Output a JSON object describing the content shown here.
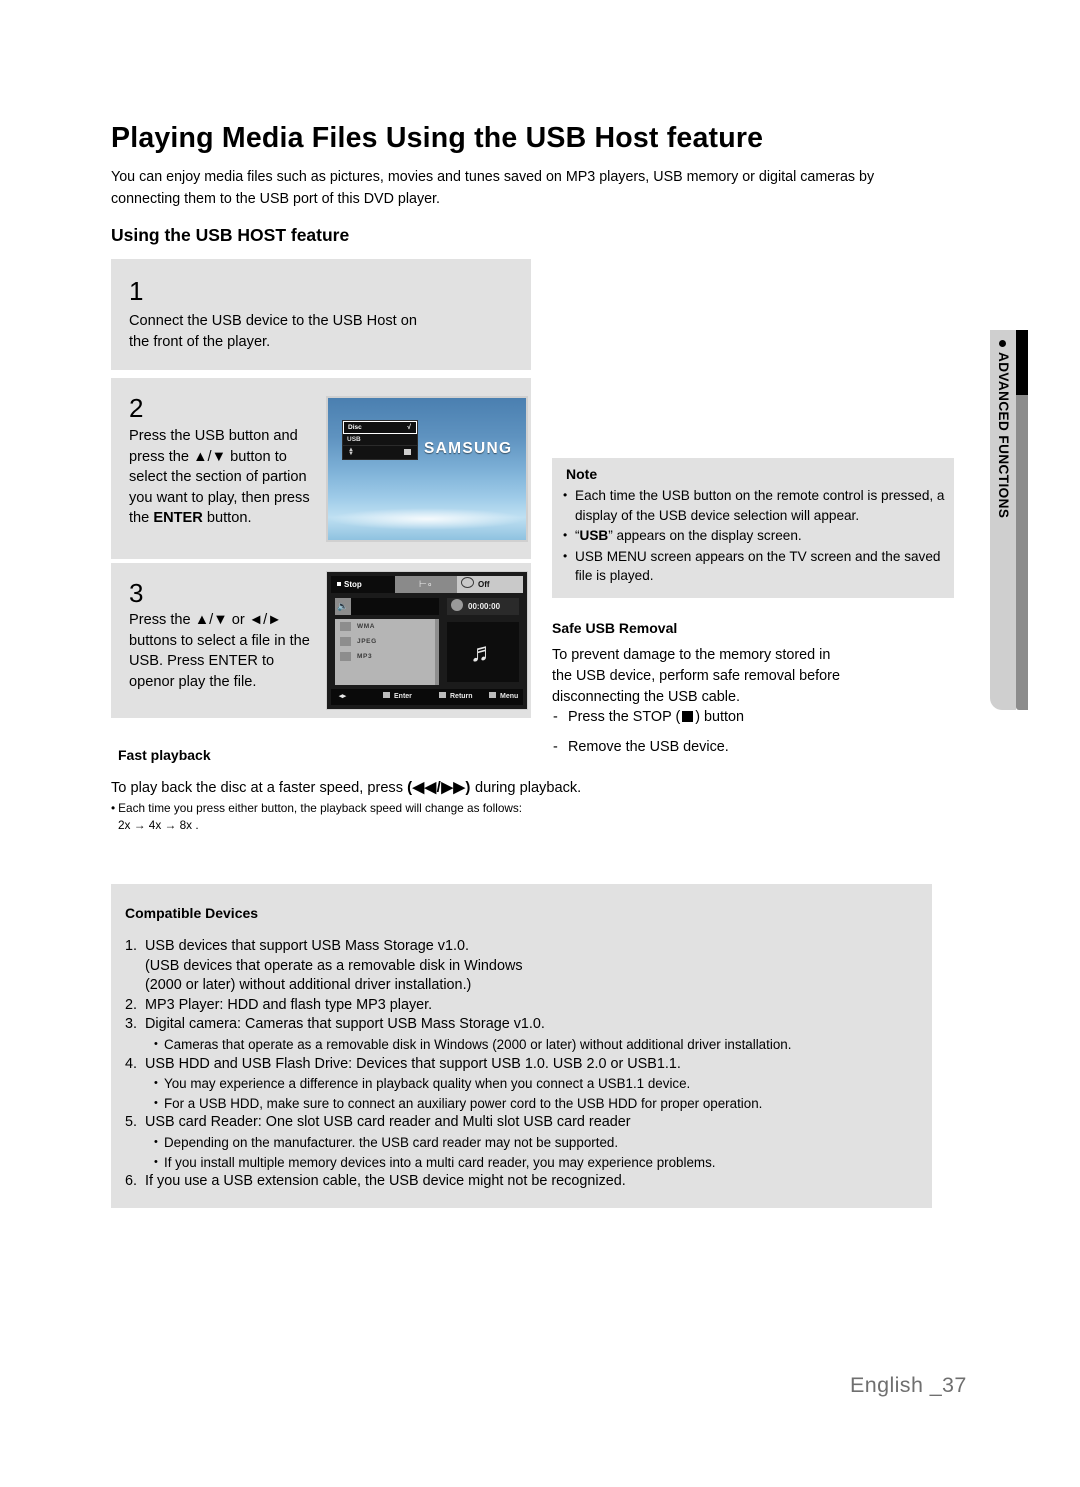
{
  "page": {
    "title": "Playing Media Files Using the USB Host feature",
    "intro": "You can enjoy media files such as pictures, movies and tunes saved on MP3 players, USB memory or digital cameras by connecting them to the USB port of this DVD player.",
    "section_heading": "Using the USB HOST feature",
    "footer": "English _37"
  },
  "side_tab": {
    "label": "ADVANCED FUNCTIONS",
    "dot": "●"
  },
  "steps": [
    {
      "number": "1",
      "text": "Connect the USB device to the USB Host on\n the front of the player."
    },
    {
      "number": "2",
      "text_before": "Press the USB button and\npress  the ▲/▼ button to\nselect the  section of partion\nyou want to play, then press\nthe  ",
      "text_bold": "ENTER",
      "text_after": " button."
    },
    {
      "number": "3",
      "text": "Press the  ▲/▼ or ◄/►\nbuttons to select a file in the\nUSB. Press ENTER to\nopenor play the file."
    }
  ],
  "tv_screen": {
    "logo": "SAMSUNG",
    "menu": [
      {
        "label": "Disc",
        "selected": true,
        "check": "√"
      },
      {
        "label": "USB",
        "selected": false,
        "check": ""
      }
    ]
  },
  "osd_screen": {
    "status": "Stop",
    "repeat": "Off",
    "time": "00:00:00",
    "file_types": [
      "WMA",
      "JPEG",
      "MP3"
    ],
    "buttons": [
      "Enter",
      "Return",
      "Menu"
    ]
  },
  "note": {
    "title": "Note",
    "items": [
      {
        "text_before": "Each time the USB button on the remote control is pressed, a display  of the USB device selection will appear.",
        "bold": "",
        "text_after": ""
      },
      {
        "text_before": "“",
        "bold": "USB",
        "text_after": "” appears on the display screen."
      },
      {
        "text_before": "USB MENU screen appears on the TV screen and the saved file is played.",
        "bold": "",
        "text_after": ""
      }
    ]
  },
  "safe_removal": {
    "title": "Safe USB Removal",
    "body": "To prevent damage to the memory stored in\nthe USB device, perform safe removal before\ndisconnecting the USB cable.",
    "step1_before": "Press the STOP (",
    "step1_after": ") button",
    "step2": "Remove the USB device."
  },
  "fast_playback": {
    "title": "Fast playback",
    "line_before": "To play back the disc at a faster speed, press  ",
    "buttons": "(◀◀/▶▶)",
    "line_after": " during playback.",
    "bullet": "Each time you press either button, the playback speed will change as follows:",
    "speeds": "2x → 4x → 8x ."
  },
  "compatible_devices": {
    "title": "Compatible Devices",
    "items": [
      {
        "num": "1.",
        "text": "USB devices that support USB Mass Storage v1.0.\n(USB devices that operate as a removable disk in Windows\n(2000 or later) without additional driver installation.)",
        "subs": []
      },
      {
        "num": "2.",
        "text": "MP3 Player: HDD and flash type MP3 player.",
        "subs": []
      },
      {
        "num": "3.",
        "text": "Digital camera: Cameras that support USB Mass Storage v1.0.",
        "subs": [
          "Cameras that operate as a removable disk in Windows (2000 or later) without additional driver installation."
        ]
      },
      {
        "num": "4.",
        "text": "USB HDD and USB Flash Drive: Devices that support USB 1.0. USB 2.0 or USB1.1.",
        "subs": [
          "You may experience a difference in playback quality when  you connect a USB1.1 device.",
          "For a USB HDD, make sure to connect an auxiliary power cord to the USB HDD for proper operation."
        ]
      },
      {
        "num": "5.",
        "text": "USB card Reader: One slot USB card reader and Multi slot USB card reader",
        "subs": [
          "Depending on the manufacturer. the USB card reader may not be supported.",
          "If you install multiple memory devices into a multi card reader, you may experience problems."
        ]
      },
      {
        "num": "6.",
        "text": "If you use a USB extension cable, the USB device might not be recognized.",
        "subs": []
      }
    ]
  },
  "colors": {
    "box_bg": "#e1e1e1",
    "tab_bg": "#cfcfcf",
    "tab_bar_gray": "#8c8c8c",
    "tab_bar_black": "#000000",
    "footer_text": "#6f6f6f"
  }
}
